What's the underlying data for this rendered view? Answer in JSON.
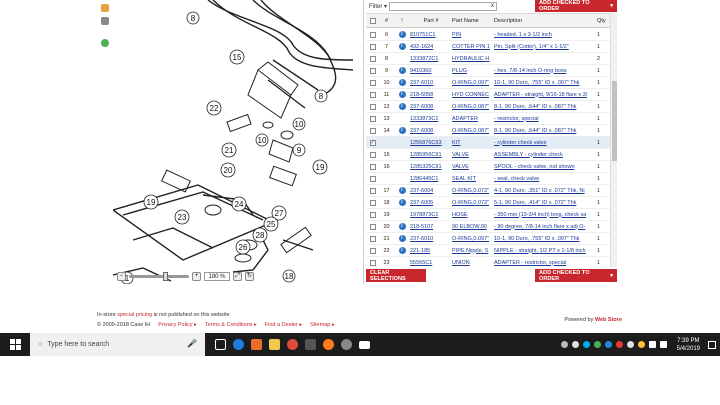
{
  "panel": {
    "filter_label": "Filter",
    "filter_arrow": "▾",
    "search_value": "",
    "search_clear": "x",
    "add_checked_label": "ADD CHECKED TO ORDER",
    "clear_selections_label": "CLEAR SELECTIONS"
  },
  "diagram": {
    "zoom_value": "180 %",
    "callouts": [
      "8",
      "15",
      "8",
      "10",
      "22",
      "10",
      "9",
      "21",
      "19",
      "20",
      "24",
      "23",
      "27",
      "19",
      "25",
      "28",
      "26",
      "1",
      "18"
    ]
  },
  "table": {
    "headers": {
      "index": "#",
      "info": "!",
      "part": "Part #",
      "name": "Part Name",
      "desc": "Description",
      "qty": "Qty"
    },
    "rows": [
      {
        "idx": "6",
        "part": "810751C1",
        "name": "PIN",
        "desc": "- headed, 1 x 3-1/2 inch",
        "qty": "1",
        "info": true,
        "checked": false
      },
      {
        "idx": "7",
        "part": "432-1624",
        "name": "COTTER PIN 1",
        "desc": "Pin, Split (Cotter), 1/4\" x 1-1/2\"",
        "qty": "1",
        "info": true,
        "checked": false
      },
      {
        "idx": "8",
        "part": "1333872C1",
        "name": "HYDRAULIC H",
        "desc": "",
        "qty": "2",
        "info": false,
        "checked": false
      },
      {
        "idx": "9",
        "part": "9410360",
        "name": "PLUG",
        "desc": "- hex, 7/8-14 inch O-ring boss",
        "qty": "1",
        "info": true,
        "checked": false
      },
      {
        "idx": "10",
        "part": "237-6010",
        "name": "O-RING,0.097\"",
        "desc": "10-1, 90 Duro, .755\" ID x .097\" Thk",
        "qty": "1",
        "info": true,
        "checked": false
      },
      {
        "idx": "11",
        "part": "218-5058",
        "name": "HYD CONNEC",
        "desc": "ADAPTER - straight, 9/16-18 flare x 3/",
        "qty": "1",
        "info": true,
        "checked": false
      },
      {
        "idx": "12",
        "part": "237-6008",
        "name": "O-RING,0.087\"",
        "desc": "8-1, 90 Duro, .644\" ID x .087\" Thk",
        "qty": "1",
        "info": true,
        "checked": false
      },
      {
        "idx": "13",
        "part": "1333873C1",
        "name": "ADAPTER",
        "desc": "- restrictor, special",
        "qty": "1",
        "info": false,
        "checked": false
      },
      {
        "idx": "14",
        "part": "237-6008",
        "name": "O-RING,0.087\"",
        "desc": "8-1, 90 Duro, .644\" ID x .087\" Thk",
        "qty": "1",
        "info": true,
        "checked": false
      },
      {
        "idx": "",
        "part": "1256876C93",
        "name": "KIT",
        "desc": "- cylinder check valve",
        "qty": "1",
        "info": false,
        "checked": true
      },
      {
        "idx": "15",
        "part": "1285956C91",
        "name": "VALVE",
        "desc": "ASSEMBLY - cylinder check",
        "qty": "1",
        "info": false,
        "checked": false
      },
      {
        "idx": "16",
        "part": "1285325C91",
        "name": "VALVE",
        "desc": "SPOOL - check valve, not shown",
        "qty": "1",
        "info": false,
        "checked": false
      },
      {
        "idx": "",
        "part": "1286445C1",
        "name": "SEAL KIT",
        "desc": "- seal, check valve",
        "qty": "1",
        "info": false,
        "checked": false
      },
      {
        "idx": "17",
        "part": "237-6004",
        "name": "O-RING,0.072\"",
        "desc": "4-1, 90 Duro, .351\" ID x .072\" Thk, Ni",
        "qty": "1",
        "info": true,
        "checked": false
      },
      {
        "idx": "18",
        "part": "237-6005",
        "name": "O-RING,0.072\"",
        "desc": "5-1, 90 Duro, .414\" ID x .072\" Thk",
        "qty": "1",
        "info": true,
        "checked": false
      },
      {
        "idx": "19",
        "part": "1978873C1",
        "name": "HOSE",
        "desc": "- 350 mm (13-3/4 inch) long, check va",
        "qty": "1",
        "info": false,
        "checked": false
      },
      {
        "idx": "20",
        "part": "218-5107",
        "name": "90 ELBOW,90",
        "desc": "- 90 degree, 7/8-14 inch flare x adj O-",
        "qty": "1",
        "info": true,
        "checked": false
      },
      {
        "idx": "21",
        "part": "237-6010",
        "name": "O-RING,0.097\"",
        "desc": "10-1, 90 Duro, .755\" ID x .097\" Thk",
        "qty": "1",
        "info": true,
        "checked": false
      },
      {
        "idx": "22",
        "part": "221-185",
        "name": "PIPE Nipple, S",
        "desc": "NIPPLE - straight, 1/2 PT x 1-1/8 inch",
        "qty": "1",
        "info": true,
        "checked": false
      },
      {
        "idx": "23",
        "part": "55565C1",
        "name": "UNION",
        "desc": "ADAPTER - restrictor, special",
        "qty": "1",
        "info": false,
        "checked": false
      }
    ]
  },
  "footer": {
    "note_prefix": "In-store ",
    "note_highlight": "special pricing",
    "note_suffix": " is not published on this website",
    "copyright": "© 2009-2018 Case IH",
    "links": [
      "Privacy Policy",
      "Terms & Conditions",
      "Find a Dealer",
      "Sitemap"
    ],
    "link_arrow": "▸",
    "powered_prefix": "Powered by ",
    "powered_brand": "Web Store"
  },
  "taskbar": {
    "search_placeholder": "Type here to search",
    "time": "7:39 PM",
    "date": "5/4/2019"
  },
  "colors": {
    "accent": "#c8282d",
    "link": "#1a3b9c",
    "taskbar": "#1c1c1c"
  }
}
